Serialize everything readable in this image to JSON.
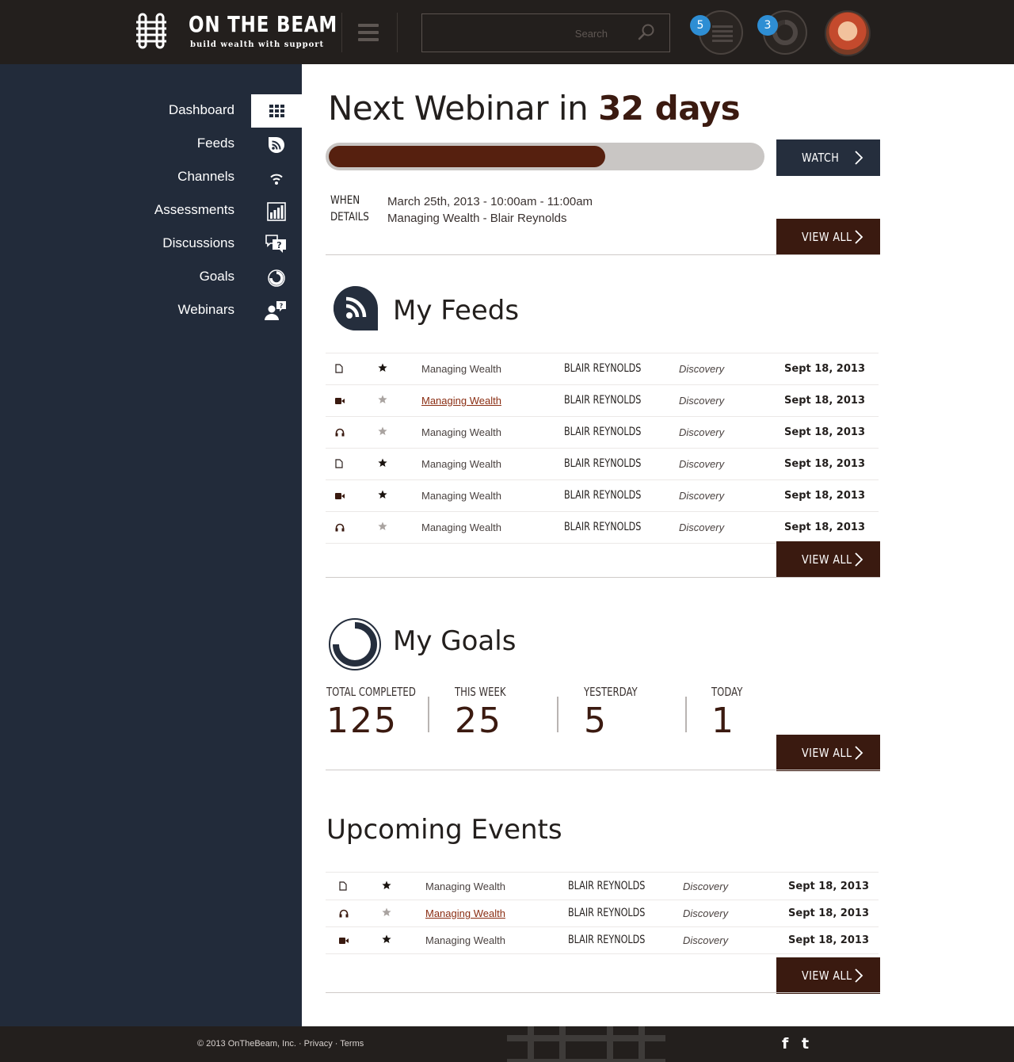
{
  "header": {
    "logo_title": "ON THE BEAM",
    "logo_subtitle": "build wealth with support",
    "search_placeholder": "Search",
    "feed_badge": "5",
    "goals_badge": "3"
  },
  "sidebar": {
    "items": [
      {
        "label": "Dashboard",
        "icon": "grid-icon",
        "active": true
      },
      {
        "label": "Feeds",
        "icon": "rss-icon"
      },
      {
        "label": "Channels",
        "icon": "wifi-icon"
      },
      {
        "label": "Assessments",
        "icon": "bar-chart-icon"
      },
      {
        "label": "Discussions",
        "icon": "question-bubble-icon"
      },
      {
        "label": "Goals",
        "icon": "progress-ring-icon"
      },
      {
        "label": "Webinars",
        "icon": "presenter-icon"
      }
    ]
  },
  "webinar": {
    "title_prefix": "Next Webinar in",
    "days": "32 days",
    "progress": 0.64,
    "watch_label": "WATCH",
    "when_label": "WHEN",
    "when_value": "March 25th, 2013 - 10:00am - 11:00am",
    "details_label": "DETAILS",
    "details_value": "Managing Wealth - Blair Reynolds",
    "view_all": "VIEW ALL"
  },
  "feeds": {
    "title": "My Feeds",
    "view_all": "VIEW ALL",
    "rows": [
      {
        "type": "document-icon",
        "starred": true,
        "title": "Managing Wealth",
        "link": false,
        "author": "BLAIR REYNOLDS",
        "category": "Discovery",
        "date": "Sept 18, 2013"
      },
      {
        "type": "video-icon",
        "starred": false,
        "title": "Managing Wealth",
        "link": true,
        "author": "BLAIR REYNOLDS",
        "category": "Discovery",
        "date": "Sept 18, 2013"
      },
      {
        "type": "headphones-icon",
        "starred": false,
        "title": "Managing Wealth",
        "link": false,
        "author": "BLAIR REYNOLDS",
        "category": "Discovery",
        "date": "Sept 18, 2013"
      },
      {
        "type": "document-icon",
        "starred": true,
        "title": "Managing Wealth",
        "link": false,
        "author": "BLAIR REYNOLDS",
        "category": "Discovery",
        "date": "Sept 18, 2013"
      },
      {
        "type": "video-icon",
        "starred": true,
        "title": "Managing Wealth",
        "link": false,
        "author": "BLAIR REYNOLDS",
        "category": "Discovery",
        "date": "Sept 18, 2013"
      },
      {
        "type": "headphones-icon",
        "starred": false,
        "title": "Managing Wealth",
        "link": false,
        "author": "BLAIR REYNOLDS",
        "category": "Discovery",
        "date": "Sept 18, 2013"
      }
    ]
  },
  "goals": {
    "title": "My Goals",
    "view_all": "VIEW ALL",
    "stats": [
      {
        "label": "TOTAL COMPLETED",
        "value": "125"
      },
      {
        "label": "THIS WEEK",
        "value": "25"
      },
      {
        "label": "YESTERDAY",
        "value": "5"
      },
      {
        "label": "TODAY",
        "value": "1"
      }
    ]
  },
  "events": {
    "title": "Upcoming Events",
    "view_all": "VIEW ALL",
    "rows": [
      {
        "type": "document-icon",
        "starred": true,
        "title": "Managing Wealth",
        "link": false,
        "author": "BLAIR REYNOLDS",
        "category": "Discovery",
        "date": "Sept 18, 2013"
      },
      {
        "type": "headphones-icon",
        "starred": false,
        "title": "Managing Wealth",
        "link": true,
        "author": "BLAIR REYNOLDS",
        "category": "Discovery",
        "date": "Sept 18, 2013"
      },
      {
        "type": "video-icon",
        "starred": true,
        "title": "Managing Wealth",
        "link": false,
        "author": "BLAIR REYNOLDS",
        "category": "Discovery",
        "date": "Sept 18, 2013"
      }
    ]
  },
  "footer": {
    "copyright": "© 2013 OnTheBeam, Inc. · Privacy · Terms",
    "facebook": "f",
    "twitter": "t"
  },
  "colors": {
    "header_bg": "#231f1d",
    "sidebar_bg": "#222b3a",
    "accent_brown": "#3a1a10",
    "progress_fill": "#56200f",
    "badge_blue": "#2e8ed4",
    "link_red": "#8a2d12"
  }
}
